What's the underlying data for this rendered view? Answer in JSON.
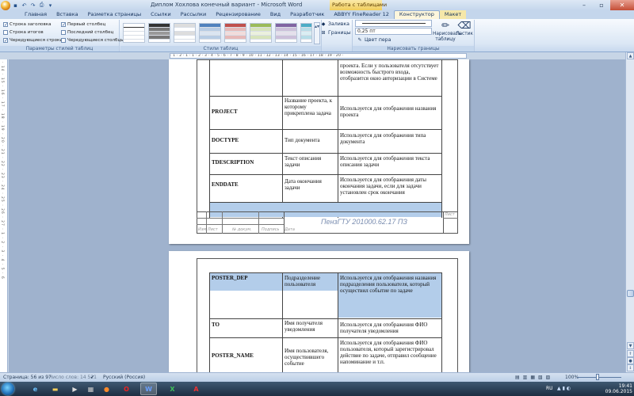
{
  "window": {
    "title": "Диплом Хохлова конечный вариант - Microsoft Word",
    "context_title": "Работа с таблицами"
  },
  "tabs": [
    {
      "label": "Главная"
    },
    {
      "label": "Вставка"
    },
    {
      "label": "Разметка страницы"
    },
    {
      "label": "Ссылки"
    },
    {
      "label": "Рассылки"
    },
    {
      "label": "Рецензирование"
    },
    {
      "label": "Вид"
    },
    {
      "label": "Разработчик"
    },
    {
      "label": "ABBYY FineReader 12"
    },
    {
      "label": "Конструктор",
      "active": true,
      "contextual": true
    },
    {
      "label": "Макет",
      "contextual": true
    }
  ],
  "ribbon": {
    "options_group_label": "Параметры стилей таблиц",
    "options": [
      {
        "label": "Строка заголовка",
        "checked": true
      },
      {
        "label": "Первый столбец",
        "checked": true
      },
      {
        "label": "Строка итогов",
        "checked": false
      },
      {
        "label": "Последний столбец",
        "checked": false
      },
      {
        "label": "Чередующиеся строки",
        "checked": true
      },
      {
        "label": "Чередующиеся столбцы",
        "checked": false
      }
    ],
    "styles_group_label": "Стили таблиц",
    "shading_label": "Заливка",
    "borders_label": "Границы",
    "line_weight": "0,25 пт",
    "pen_color_label": "Цвет пера",
    "draw_group_label": "Нарисовать границы",
    "draw_table_label": "Нарисовать таблицу",
    "eraser_label": "Ластик"
  },
  "ruler": {
    "marks": "· 1 · 2 · 1 · 1 · 2 · 3 · 4 · 5 · 6 · 7 · 8 · 9 · 10 · 11 · 12 · 13 · 14 · 15 · 16 · 17 · 18 · 19 · 20 · ",
    "vmarks": "· 14 · 15 · 16 · 17 · 18 · 19 · 20 · 21 · 22 · 23 · 24 · 25 · 26 · 27 · 1 · 2 · 3 · 4 · 5 · 6"
  },
  "page1": {
    "rows": [
      {
        "field": "",
        "name": "",
        "desc": "проекта. Если у пользователя отсутствует возможность быстрого входа, отобразится окно авторизации в Системе"
      },
      {
        "field": "PROJECT",
        "name": "Название проекта, к которому прикреплена задача",
        "desc": "Используется для отображения названия проекта"
      },
      {
        "field": "DOCTYPE",
        "name": "Тип документа",
        "desc": "Используется для отображения типа документа"
      },
      {
        "field": "TDESCRIPTION",
        "name": "Текст описания задачи",
        "desc": "Используется для отображения текста описания задачи"
      },
      {
        "field": "ENDDATE",
        "name": "Дата окончания задачи",
        "desc": "Используется для отображения даты окончания задачи, если для задачи установлен срок окончания"
      }
    ],
    "stamp": {
      "labels": [
        "Изм",
        "Лист",
        "№ докум.",
        "Подпись",
        "Дата"
      ],
      "code": "ПензГТУ 201000.62.17  ПЗ",
      "sheet_label": "Лист"
    }
  },
  "page2": {
    "rows": [
      {
        "field": "POSTER_DEP",
        "name": "Подразделение пользователя",
        "desc": "Используется для отображения названия подразделения пользователя, который осуществил событие по задаче"
      },
      {
        "field": "TO",
        "name": "Имя получателя уведомления",
        "desc": "Используется для отображения ФИО получателя уведомления"
      },
      {
        "field": "POSTER_NAME",
        "name": "Имя пользователя, осуществившего событие",
        "desc": "Используется для отображения ФИО пользователя, который зарегистрировал действие по задаче, отправил сообщение напоминание и т.п."
      }
    ]
  },
  "status": {
    "page": "Страница: 56 из 97",
    "words": "Число слов: 14 521",
    "language": "Русский (Россия)",
    "zoom": "100%"
  },
  "taskbar": {
    "lang": "RU",
    "time": "19:41",
    "date": "09.06.2015"
  }
}
